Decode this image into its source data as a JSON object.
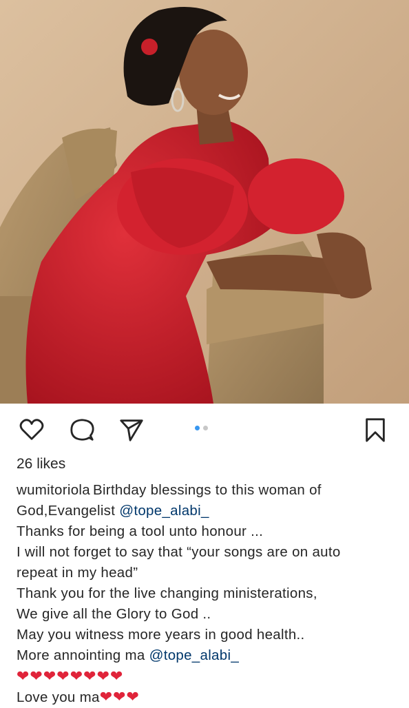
{
  "post": {
    "likes_text": "26 likes",
    "username": "wumitoriola",
    "carousel": {
      "total": 2,
      "active": 0
    },
    "caption_lines": [
      {
        "pre": "Birthday blessings to this woman of",
        "mention": "",
        "post": ""
      },
      {
        "pre": "God,Evangelist ",
        "mention": "@tope_alabi_",
        "post": ""
      },
      {
        "pre": "Thanks for being a tool unto honour ...",
        "mention": "",
        "post": ""
      },
      {
        "pre": "I will not forget to say that “your songs are on auto",
        "mention": "",
        "post": ""
      },
      {
        "pre": "repeat in my head”",
        "mention": "",
        "post": ""
      },
      {
        "pre": "Thank you for the live changing ministerations,",
        "mention": "",
        "post": ""
      },
      {
        "pre": "We give all the Glory to God ..",
        "mention": "",
        "post": ""
      },
      {
        "pre": "May you witness more years in good health..",
        "mention": "",
        "post": ""
      },
      {
        "pre": "More annointing  ma ",
        "mention": "@tope_alabi_",
        "post": ""
      }
    ],
    "hearts_line": "❤❤❤❤❤❤❤❤",
    "last_line_text": "Love you ma",
    "last_line_hearts": "❤❤❤"
  },
  "icons": {
    "like": "heart-outline-icon",
    "comment": "comment-bubble-icon",
    "share": "paper-plane-icon",
    "save": "bookmark-icon"
  },
  "colors": {
    "text": "#262626",
    "mention": "#00376b",
    "carousel_active": "#3897f0",
    "heart": "#e0243a"
  }
}
